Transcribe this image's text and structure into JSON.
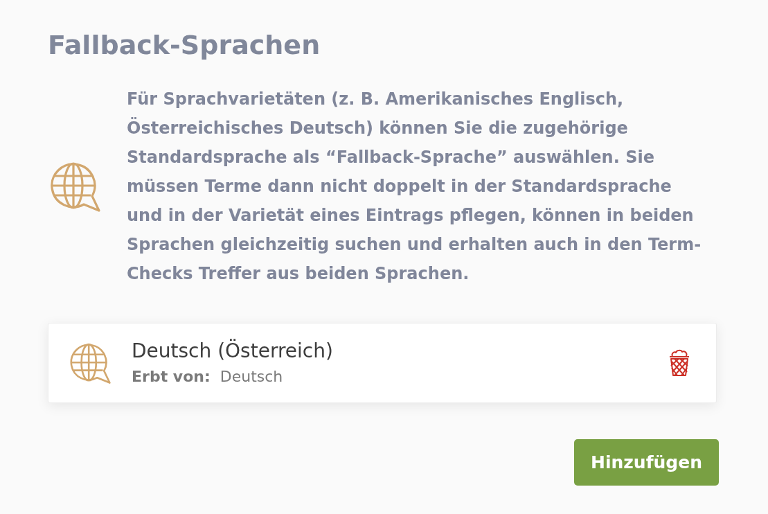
{
  "title": "Fallback-Sprachen",
  "description": "Für Sprachvarietäten (z. B. Amerikanisches Englisch, Österreichisches Deutsch) können Sie die zugehörige Standardsprache als “Fallback-Sprache” auswählen. Sie müssen Terme dann nicht doppelt in der Standardsprache und in der Varietät eines Eintrags pflegen, können in beiden Sprachen gleichzeitig suchen und erhalten auch in den Term-Checks Treffer aus beiden Sprachen.",
  "languages": [
    {
      "name": "Deutsch (Österreich)",
      "inherits_label": "Erbt von:",
      "inherits_value": "Deutsch"
    }
  ],
  "add_button": "Hinzufügen"
}
